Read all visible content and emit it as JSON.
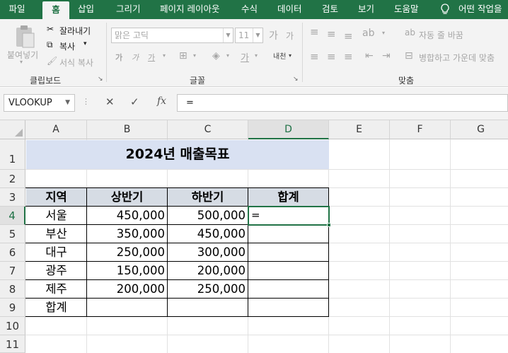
{
  "ribbon": {
    "tabs": [
      "파일",
      "홈",
      "삽입",
      "그리기",
      "페이지 레이아웃",
      "수식",
      "데이터",
      "검토",
      "보기",
      "도움말",
      "어떤 작업을"
    ],
    "active_tab": "홈",
    "clipboard": {
      "paste_label": "붙여넣기",
      "cut_label": "잘라내기",
      "copy_label": "복사",
      "format_painter_label": "서식 복사",
      "group_label": "클립보드"
    },
    "font": {
      "font_name": "맑은 고딕",
      "font_size": "11",
      "grow_label": "가",
      "shrink_label": "가",
      "bold_label": "가",
      "italic_label": "가",
      "underline_label": "가",
      "font_color_label": "가",
      "phonetic_label": "내천",
      "group_label": "글꼴"
    },
    "alignment": {
      "wrap_text_label": "자동 줄 바꿈",
      "merge_label": "병합하고 가운데 맞춤",
      "group_label": "맞춤"
    }
  },
  "formula_bar": {
    "name_box": "VLOOKUP",
    "cancel": "✕",
    "enter": "✓",
    "fx": "fx",
    "formula": "="
  },
  "grid": {
    "columns": [
      "A",
      "B",
      "C",
      "D",
      "E",
      "F",
      "G"
    ],
    "rows": [
      "1",
      "2",
      "3",
      "4",
      "5",
      "6",
      "7",
      "8",
      "9",
      "10",
      "11"
    ],
    "selected_column": "D",
    "selected_row": "4"
  },
  "sheet": {
    "title": "2024년 매출목표",
    "headers": [
      "지역",
      "상반기",
      "하반기",
      "합계"
    ],
    "regions": [
      "서울",
      "부산",
      "대구",
      "광주",
      "제주"
    ],
    "h1": [
      "450,000",
      "350,000",
      "250,000",
      "150,000",
      "200,000"
    ],
    "h2": [
      "500,000",
      "450,000",
      "300,000",
      "200,000",
      "250,000"
    ],
    "total_label": "합계",
    "active_cell_entry": "="
  },
  "colors": {
    "accent": "#217346",
    "title_fill": "#d9e1f2",
    "header_fill": "#d6dce4"
  }
}
